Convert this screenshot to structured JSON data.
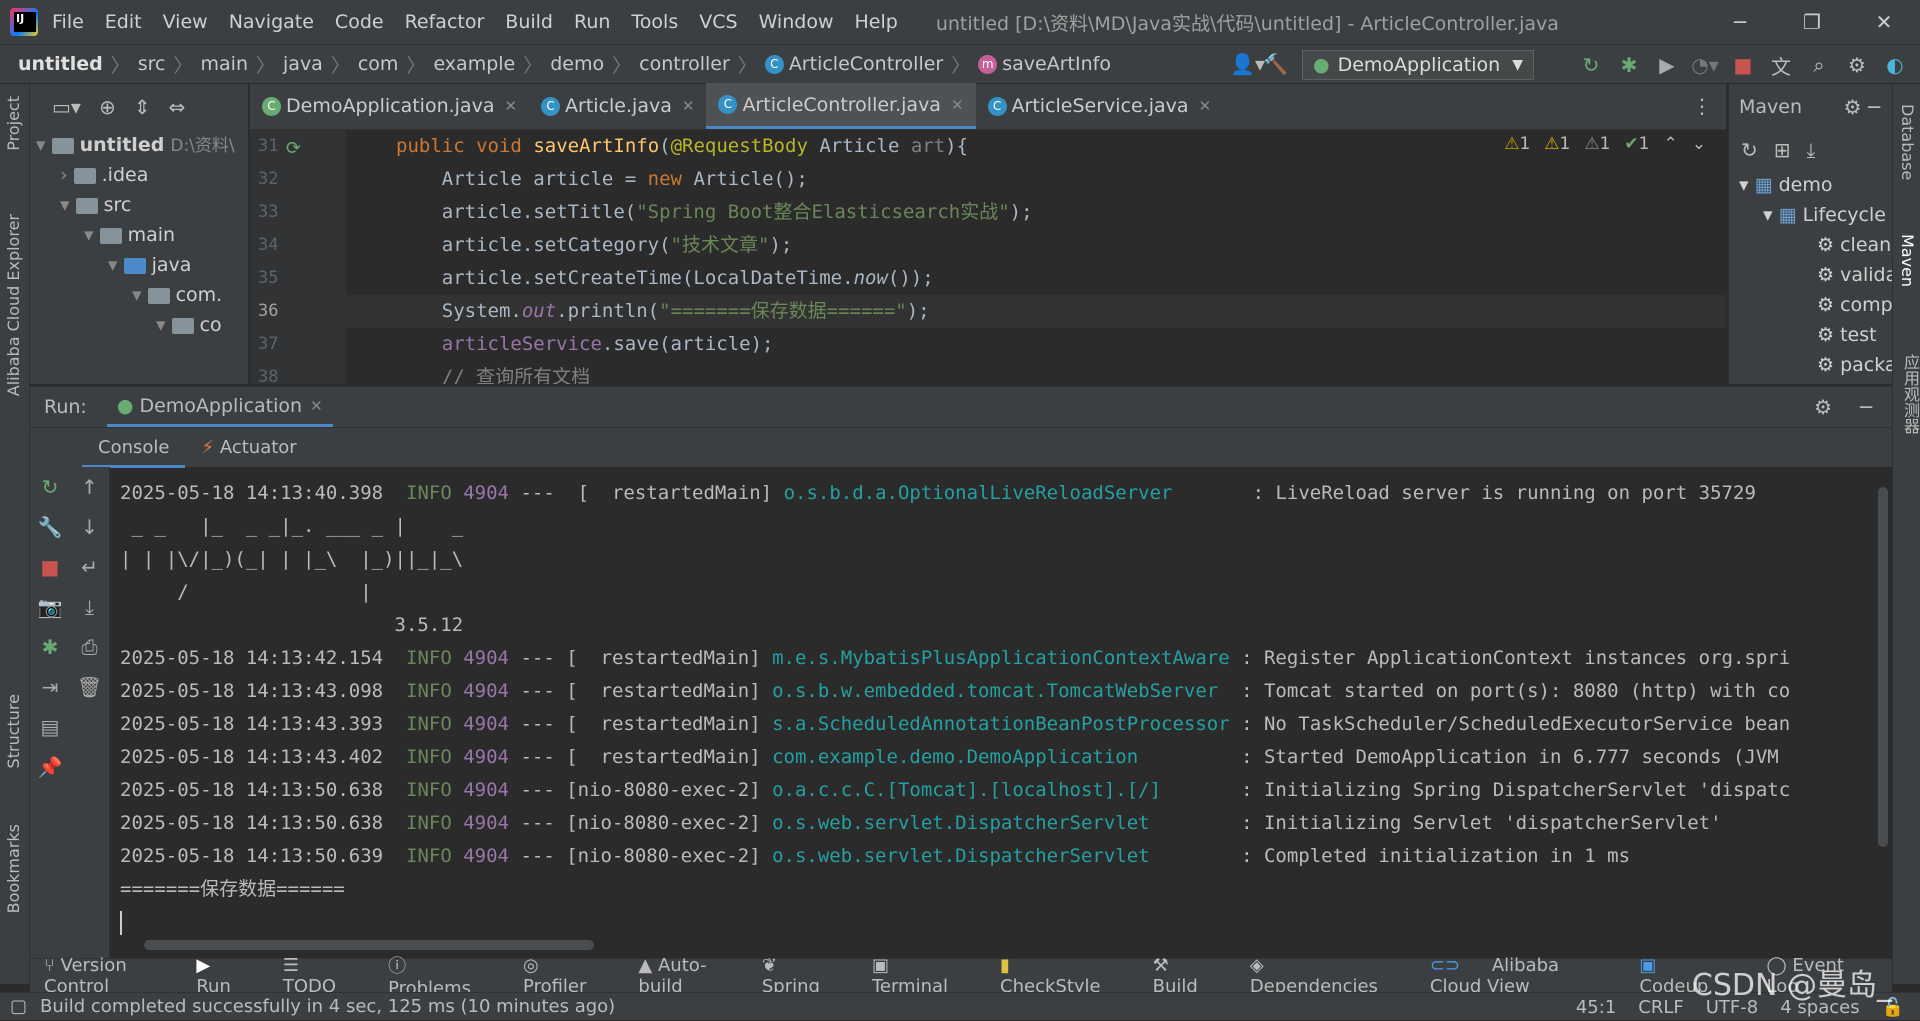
{
  "menu": [
    "File",
    "Edit",
    "View",
    "Navigate",
    "Code",
    "Refactor",
    "Build",
    "Run",
    "Tools",
    "VCS",
    "Window",
    "Help"
  ],
  "window_title": "untitled [D:\\资料\\MD\\Java实战\\代码\\untitled] - ArticleController.java",
  "breadcrumbs": [
    "untitled",
    "src",
    "main",
    "java",
    "com",
    "example",
    "demo",
    "controller",
    "ArticleController",
    "saveArtInfo"
  ],
  "run_config": "DemoApplication",
  "project_tree": [
    {
      "label": "untitled",
      "extra": "D:\\资料\\"
    },
    {
      "label": ".idea"
    },
    {
      "label": "src"
    },
    {
      "label": "main"
    },
    {
      "label": "java"
    },
    {
      "label": "com."
    },
    {
      "label": "co"
    }
  ],
  "left_tabs": {
    "project": "Project",
    "cloud": "Alibaba Cloud Explorer",
    "structure": "Structure",
    "bookmarks": "Bookmarks"
  },
  "right_tabs": {
    "database": "Database",
    "maven": "Maven",
    "app": "应用观测器"
  },
  "editor_tabs": [
    "DemoApplication.java",
    "Article.java",
    "ArticleController.java",
    "ArticleService.java"
  ],
  "line_numbers": [
    "31",
    "32",
    "33",
    "34",
    "35",
    "36",
    "37",
    "38"
  ],
  "code": {
    "l31_kw1": "public",
    "l31_kw2": "void",
    "l31_fn": "saveArtInfo",
    "l31_ann": "@RequestBody",
    "l31_rest": " Article ",
    "l31_par": "art",
    "l31_end": "){",
    "l32_a": "    Article article = ",
    "l32_kw": "new",
    "l32_b": " Article();",
    "l33_a": "    article.setTitle(",
    "l33_s": "\"Spring Boot整合Elasticsearch实战\"",
    "l33_b": ");",
    "l34_a": "    article.setCategory(",
    "l34_s": "\"技术文章\"",
    "l34_b": ");",
    "l35_a": "    article.setCreateTime(LocalDateTime.",
    "l35_it": "now",
    "l35_b": "());",
    "l36_a": "    System.",
    "l36_it": "out",
    "l36_b": ".println(",
    "l36_s": "\"=======保存数据======\"",
    "l36_c": ");",
    "l37_f": "    articleService",
    "l37_b": ".save(article);",
    "l38": "    // 查询所有文档"
  },
  "warnings": [
    "1",
    "1",
    "1",
    "1"
  ],
  "maven": {
    "title": "Maven",
    "items": [
      "demo",
      "Lifecycle",
      "clean",
      "validate",
      "compile",
      "test",
      "package"
    ]
  },
  "run": {
    "label": "Run:",
    "tab": "DemoApplication",
    "subtabs": [
      "Console",
      "Actuator"
    ]
  },
  "console": [
    {
      "ts": "2025-05-18 14:13:40.398",
      "lvl": "INFO",
      "pid": "4904",
      "th": "---  [  restartedMain]",
      "lg": "o.s.b.d.a.OptionalLiveReloadServer      ",
      "msg": " : LiveReload server is running on port 35729"
    },
    {
      "raw": " _ _   |_  _ _|_. ___ _ |    _"
    },
    {
      "raw": "| | |\\/|_)(_| | |_\\  |_)||_|_\\"
    },
    {
      "raw": "     /               |"
    },
    {
      "raw": "                        3.5.12"
    },
    {
      "ts": "2025-05-18 14:13:42.154",
      "lvl": "INFO",
      "pid": "4904",
      "th": "--- [  restartedMain]",
      "lg": "m.e.s.MybatisPlusApplicationContextAware",
      "msg": " : Register ApplicationContext instances org.spri"
    },
    {
      "ts": "2025-05-18 14:13:43.098",
      "lvl": "INFO",
      "pid": "4904",
      "th": "--- [  restartedMain]",
      "lg": "o.s.b.w.embedded.tomcat.TomcatWebServer ",
      "msg": " : Tomcat started on port(s): 8080 (http) with co"
    },
    {
      "ts": "2025-05-18 14:13:43.393",
      "lvl": "INFO",
      "pid": "4904",
      "th": "--- [  restartedMain]",
      "lg": "s.a.ScheduledAnnotationBeanPostProcessor",
      "msg": " : No TaskScheduler/ScheduledExecutorService bean"
    },
    {
      "ts": "2025-05-18 14:13:43.402",
      "lvl": "INFO",
      "pid": "4904",
      "th": "--- [  restartedMain]",
      "lg": "com.example.demo.DemoApplication        ",
      "msg": " : Started DemoApplication in 6.777 seconds (JVM"
    },
    {
      "ts": "2025-05-18 14:13:50.638",
      "lvl": "INFO",
      "pid": "4904",
      "th": "--- [nio-8080-exec-2]",
      "lg": "o.a.c.c.C.[Tomcat].[localhost].[/]      ",
      "msg": " : Initializing Spring DispatcherServlet 'dispatc"
    },
    {
      "ts": "2025-05-18 14:13:50.638",
      "lvl": "INFO",
      "pid": "4904",
      "th": "--- [nio-8080-exec-2]",
      "lg": "o.s.web.servlet.DispatcherServlet       ",
      "msg": " : Initializing Servlet 'dispatcherServlet'"
    },
    {
      "ts": "2025-05-18 14:13:50.639",
      "lvl": "INFO",
      "pid": "4904",
      "th": "--- [nio-8080-exec-2]",
      "lg": "o.s.web.servlet.DispatcherServlet       ",
      "msg": " : Completed initialization in 1 ms"
    },
    {
      "raw": "=======保存数据======"
    }
  ],
  "bottom_tools": [
    "Version Control",
    "Run",
    "TODO",
    "Problems",
    "Profiler",
    "Auto-build",
    "Spring",
    "Terminal",
    "CheckStyle",
    "Build",
    "Dependencies",
    "Alibaba Cloud View",
    "Codeup",
    "Event Log"
  ],
  "status": {
    "message": "Build completed successfully in 4 sec, 125 ms (10 minutes ago)",
    "position": "45:1",
    "line_sep": "CRLF",
    "encoding": "UTF-8",
    "indent": "4 spaces"
  },
  "watermark": "CSDN @曼岛_"
}
